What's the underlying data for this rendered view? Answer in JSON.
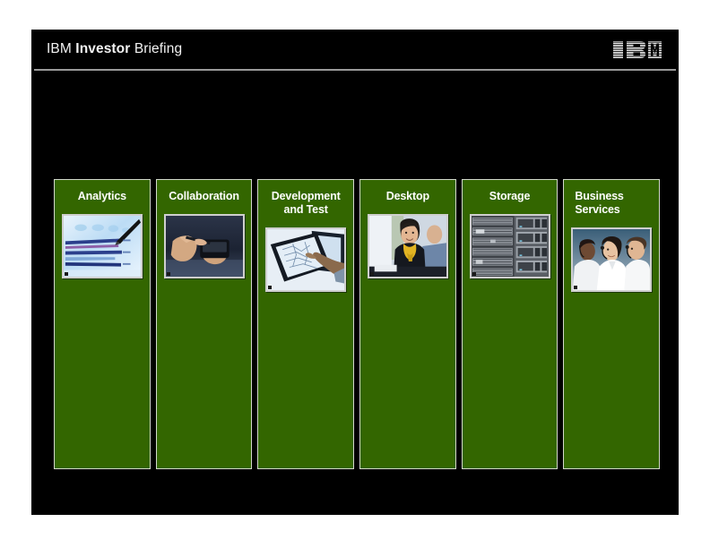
{
  "slide": {
    "background_color": "#000000",
    "page_background_color": "#ffffff",
    "accent_green": "#336600",
    "border_color": "#d2d8cb"
  },
  "header": {
    "brand_prefix": "IBM",
    "brand_bold": "Investor",
    "brand_suffix": "Briefing",
    "logo_name": "ibm-logo",
    "logo_text": "IBM",
    "rule_color": "#9a9a9a"
  },
  "columns": [
    {
      "label": "Analytics",
      "align": "center",
      "thumbnail_name": "analytics-bar-chart-thumbnail",
      "thumbnail_description": "blue bar chart with stylus pointer"
    },
    {
      "label": "Collaboration",
      "align": "center",
      "thumbnail_name": "collaboration-handheld-device-thumbnail",
      "thumbnail_description": "hands holding a handheld device with stylus"
    },
    {
      "label": "Development and Test",
      "align": "center",
      "thumbnail_name": "development-and-test-tablet-thumbnail",
      "thumbnail_description": "hand pointing at tablet screen with diagrams"
    },
    {
      "label": "Desktop",
      "align": "center",
      "thumbnail_name": "desktop-businesswoman-thumbnail",
      "thumbnail_description": "smiling businesswoman with yellow scarf"
    },
    {
      "label": "Storage",
      "align": "center",
      "thumbnail_name": "storage-server-rack-thumbnail",
      "thumbnail_description": "grey server and storage racks"
    },
    {
      "label": "Business Services",
      "align": "left",
      "thumbnail_name": "business-services-call-center-thumbnail",
      "thumbnail_description": "call center agents wearing headsets"
    }
  ]
}
